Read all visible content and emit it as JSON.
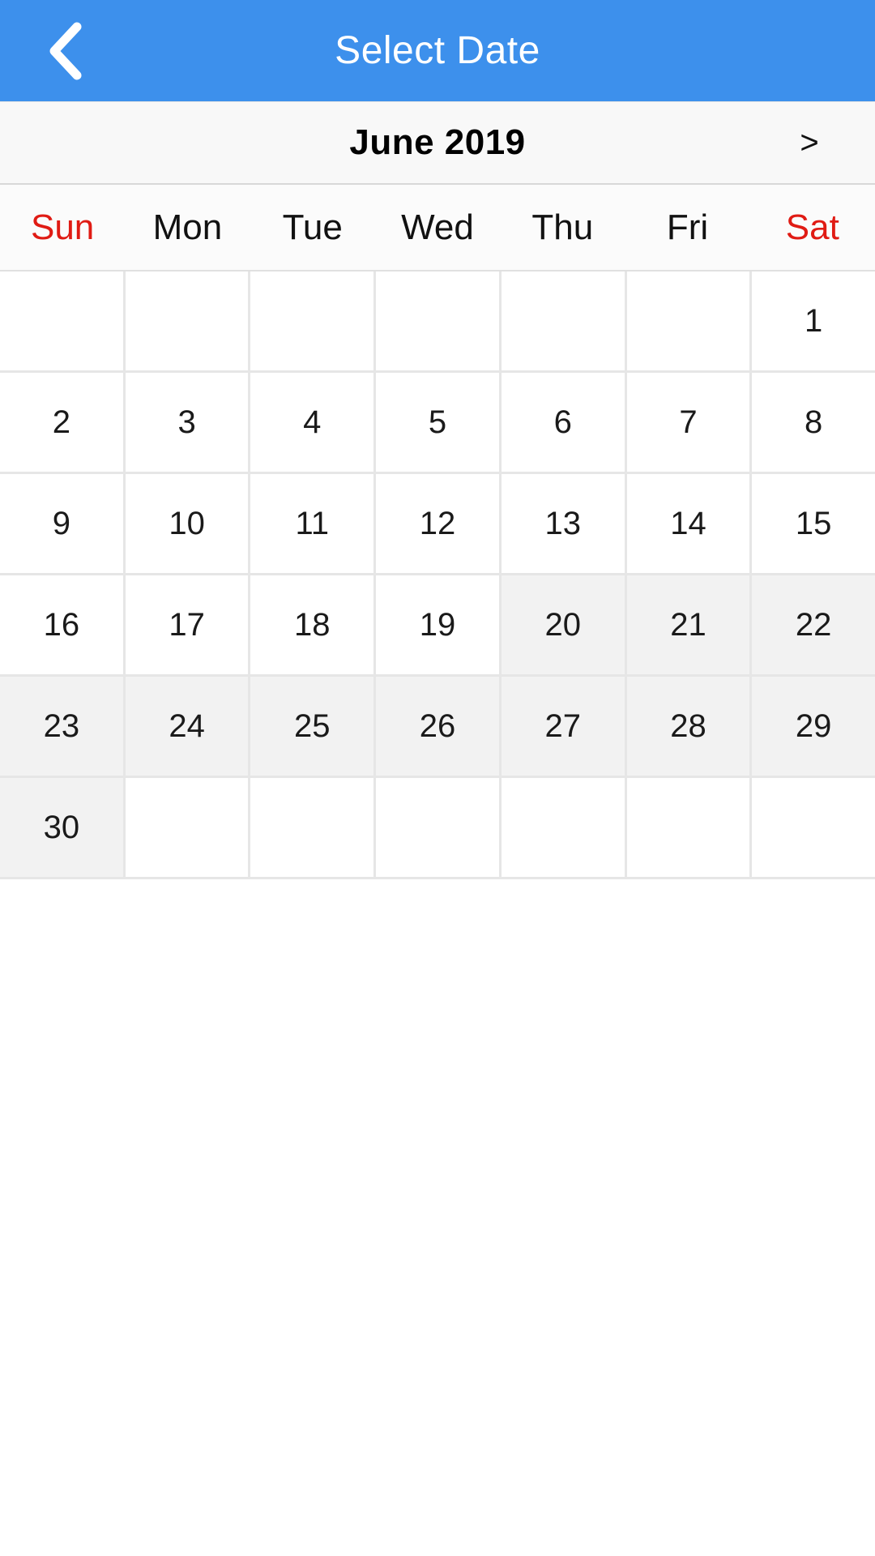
{
  "appbar": {
    "title": "Select Date",
    "back_icon": "chevron-left-icon",
    "background_color": "#3d90ec",
    "text_color": "#ffffff"
  },
  "month_nav": {
    "label": "June 2019",
    "next_label": ">",
    "prev_label": "",
    "background_color": "#f8f8f8"
  },
  "weekdays": [
    {
      "label": "Sun",
      "weekend": true
    },
    {
      "label": "Mon",
      "weekend": false
    },
    {
      "label": "Tue",
      "weekend": false
    },
    {
      "label": "Wed",
      "weekend": false
    },
    {
      "label": "Thu",
      "weekend": false
    },
    {
      "label": "Fri",
      "weekend": false
    },
    {
      "label": "Sat",
      "weekend": true
    }
  ],
  "colors": {
    "accent": "#3d90ec",
    "weekend_text": "#e01b14",
    "highlight_cell": "#f2f2f2",
    "grid_line": "#e6e6e6",
    "day_text": "#1a1a1a"
  },
  "calendar": {
    "month": "June",
    "year": "2019",
    "rows": [
      [
        {
          "label": "",
          "empty": true,
          "highlighted": false
        },
        {
          "label": "",
          "empty": true,
          "highlighted": false
        },
        {
          "label": "",
          "empty": true,
          "highlighted": false
        },
        {
          "label": "",
          "empty": true,
          "highlighted": false
        },
        {
          "label": "",
          "empty": true,
          "highlighted": false
        },
        {
          "label": "",
          "empty": true,
          "highlighted": false
        },
        {
          "label": "1",
          "empty": false,
          "highlighted": false
        }
      ],
      [
        {
          "label": "2",
          "empty": false,
          "highlighted": false
        },
        {
          "label": "3",
          "empty": false,
          "highlighted": false
        },
        {
          "label": "4",
          "empty": false,
          "highlighted": false
        },
        {
          "label": "5",
          "empty": false,
          "highlighted": false
        },
        {
          "label": "6",
          "empty": false,
          "highlighted": false
        },
        {
          "label": "7",
          "empty": false,
          "highlighted": false
        },
        {
          "label": "8",
          "empty": false,
          "highlighted": false
        }
      ],
      [
        {
          "label": "9",
          "empty": false,
          "highlighted": false
        },
        {
          "label": "10",
          "empty": false,
          "highlighted": false
        },
        {
          "label": "11",
          "empty": false,
          "highlighted": false
        },
        {
          "label": "12",
          "empty": false,
          "highlighted": false
        },
        {
          "label": "13",
          "empty": false,
          "highlighted": false
        },
        {
          "label": "14",
          "empty": false,
          "highlighted": false
        },
        {
          "label": "15",
          "empty": false,
          "highlighted": false
        }
      ],
      [
        {
          "label": "16",
          "empty": false,
          "highlighted": false
        },
        {
          "label": "17",
          "empty": false,
          "highlighted": false
        },
        {
          "label": "18",
          "empty": false,
          "highlighted": false
        },
        {
          "label": "19",
          "empty": false,
          "highlighted": false
        },
        {
          "label": "20",
          "empty": false,
          "highlighted": true
        },
        {
          "label": "21",
          "empty": false,
          "highlighted": true
        },
        {
          "label": "22",
          "empty": false,
          "highlighted": true
        }
      ],
      [
        {
          "label": "23",
          "empty": false,
          "highlighted": true
        },
        {
          "label": "24",
          "empty": false,
          "highlighted": true
        },
        {
          "label": "25",
          "empty": false,
          "highlighted": true
        },
        {
          "label": "26",
          "empty": false,
          "highlighted": true
        },
        {
          "label": "27",
          "empty": false,
          "highlighted": true
        },
        {
          "label": "28",
          "empty": false,
          "highlighted": true
        },
        {
          "label": "29",
          "empty": false,
          "highlighted": true
        }
      ],
      [
        {
          "label": "30",
          "empty": false,
          "highlighted": true
        },
        {
          "label": "",
          "empty": true,
          "highlighted": false
        },
        {
          "label": "",
          "empty": true,
          "highlighted": false
        },
        {
          "label": "",
          "empty": true,
          "highlighted": false
        },
        {
          "label": "",
          "empty": true,
          "highlighted": false
        },
        {
          "label": "",
          "empty": true,
          "highlighted": false
        },
        {
          "label": "",
          "empty": true,
          "highlighted": false
        }
      ]
    ]
  }
}
